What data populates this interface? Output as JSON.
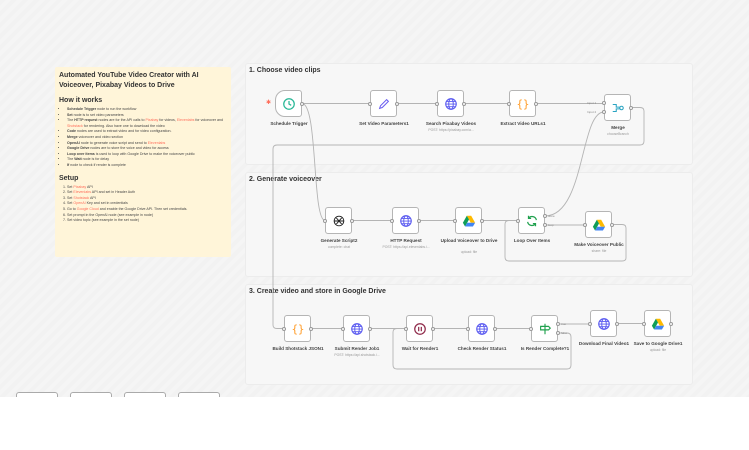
{
  "note": {
    "title": "Automated YouTube Video Creator with AI Voiceover, Pixabay Videos to Drive",
    "how_heading": "How it works",
    "how_items": [
      [
        {
          "b": "Schedule Trigger"
        },
        {
          "t": " node to run the workflow"
        }
      ],
      [
        {
          "b": "Set"
        },
        {
          "t": " node is to set video parameters"
        }
      ],
      [
        {
          "t": "The "
        },
        {
          "b": "HTTP request"
        },
        {
          "t": " nodes are for the API calls to "
        },
        {
          "l": "Pixabay"
        },
        {
          "t": " for videos, "
        },
        {
          "l": "Elevenlabs"
        },
        {
          "t": " for voiceover and "
        },
        {
          "l": "Shotstack"
        },
        {
          "t": " for rendering. Also have one to download the video"
        }
      ],
      [
        {
          "b": "Code"
        },
        {
          "t": " nodes are used to extract video and for video configuration."
        }
      ],
      [
        {
          "b": "Merge"
        },
        {
          "t": " voiceover and video section"
        }
      ],
      [
        {
          "b": "OpenAI"
        },
        {
          "t": " node to generate voice script and send to "
        },
        {
          "l": "Elevenlabs"
        }
      ],
      [
        {
          "b": "Google Drive"
        },
        {
          "t": " nodes are to store the voice and video for access"
        }
      ],
      [
        {
          "b": "Loop over items"
        },
        {
          "t": " is used to loop with Google Drive to make the voiceover public"
        }
      ],
      [
        {
          "t": "The "
        },
        {
          "b": "Wait"
        },
        {
          "t": " node is for delay"
        }
      ],
      [
        {
          "b": "If"
        },
        {
          "t": " node to check if render is complete"
        }
      ]
    ],
    "setup_heading": "Setup",
    "setup_items": [
      [
        {
          "t": "Set "
        },
        {
          "l": "Pixabay"
        },
        {
          "t": " API"
        }
      ],
      [
        {
          "t": "Set "
        },
        {
          "l": "Elevenlabs"
        },
        {
          "t": " API and set in Header Auth"
        }
      ],
      [
        {
          "t": "Set "
        },
        {
          "l": "Shotstack"
        },
        {
          "t": " API"
        }
      ],
      [
        {
          "t": "Set "
        },
        {
          "l": "OpenAI"
        },
        {
          "t": " Key and set in credentials"
        }
      ],
      [
        {
          "t": "Go to "
        },
        {
          "l": "Google Cloud"
        },
        {
          "t": " and enable the Google Drive API. Then set credentials."
        }
      ],
      [
        {
          "t": "Set prompt in the OpenAI node (see example in node)"
        }
      ],
      [
        {
          "t": "Set video topic (see example in the set node)"
        }
      ]
    ]
  },
  "sections": [
    {
      "title": "1. Choose video clips"
    },
    {
      "title": "2. Generate voiceover"
    },
    {
      "title": "3. Create video and store in Google Drive"
    }
  ],
  "nodes": [
    {
      "label": "Schedule Trigger",
      "sub": "",
      "icon": "clock-icon"
    },
    {
      "label": "Set Video Parameters1",
      "sub": "",
      "icon": "pencil-icon"
    },
    {
      "label": "Search Pixabay Videos",
      "sub": "POST: https://pixabay.com/a...",
      "icon": "globe-icon"
    },
    {
      "label": "Extract Video URLs1",
      "sub": "",
      "icon": "code-braces-icon"
    },
    {
      "label": "Merge",
      "sub": "chooseBranch",
      "icon": "merge-icon",
      "inputs": [
        "Input 1",
        "Input 2"
      ]
    },
    {
      "label": "Generate Script2",
      "sub": "complete: chat",
      "icon": "openai-icon"
    },
    {
      "label": "HTTP Request",
      "sub": "POST: https://api.elevenlabs.i...",
      "icon": "globe-icon"
    },
    {
      "label": "Upload Voiceover to Drive",
      "sub": "upload: file",
      "icon": "google-drive-icon"
    },
    {
      "label": "Loop Over Items",
      "sub": "",
      "icon": "loop-icon",
      "outputs": [
        "done",
        "loop"
      ]
    },
    {
      "label": "Make Voiceover Public",
      "sub": "share: file",
      "icon": "google-drive-icon"
    },
    {
      "label": "Build Shotstack JSON1",
      "sub": "",
      "icon": "code-braces-icon"
    },
    {
      "label": "Submit Render Job1",
      "sub": "POST: https://api.shotstack.i...",
      "icon": "globe-icon"
    },
    {
      "label": "Wait for Render1",
      "sub": "",
      "icon": "pause-icon"
    },
    {
      "label": "Check Render Status1",
      "sub": "",
      "icon": "globe-icon"
    },
    {
      "label": "Is Render Complete?1",
      "sub": "",
      "icon": "if-signpost-icon",
      "outputs": [
        "true",
        "false"
      ]
    },
    {
      "label": "Download Final Video1",
      "sub": "",
      "icon": "globe-icon"
    },
    {
      "label": "Save to Google Drive1",
      "sub": "upload: file",
      "icon": "google-drive-icon"
    }
  ],
  "colors": {
    "accent": "#ff6d5a",
    "globe": "#5b5bf0",
    "code": "#ff9922",
    "trigger": "#27b796",
    "wait": "#8f2a4a",
    "if": "#20a14e",
    "merge": "#29a4c2"
  }
}
